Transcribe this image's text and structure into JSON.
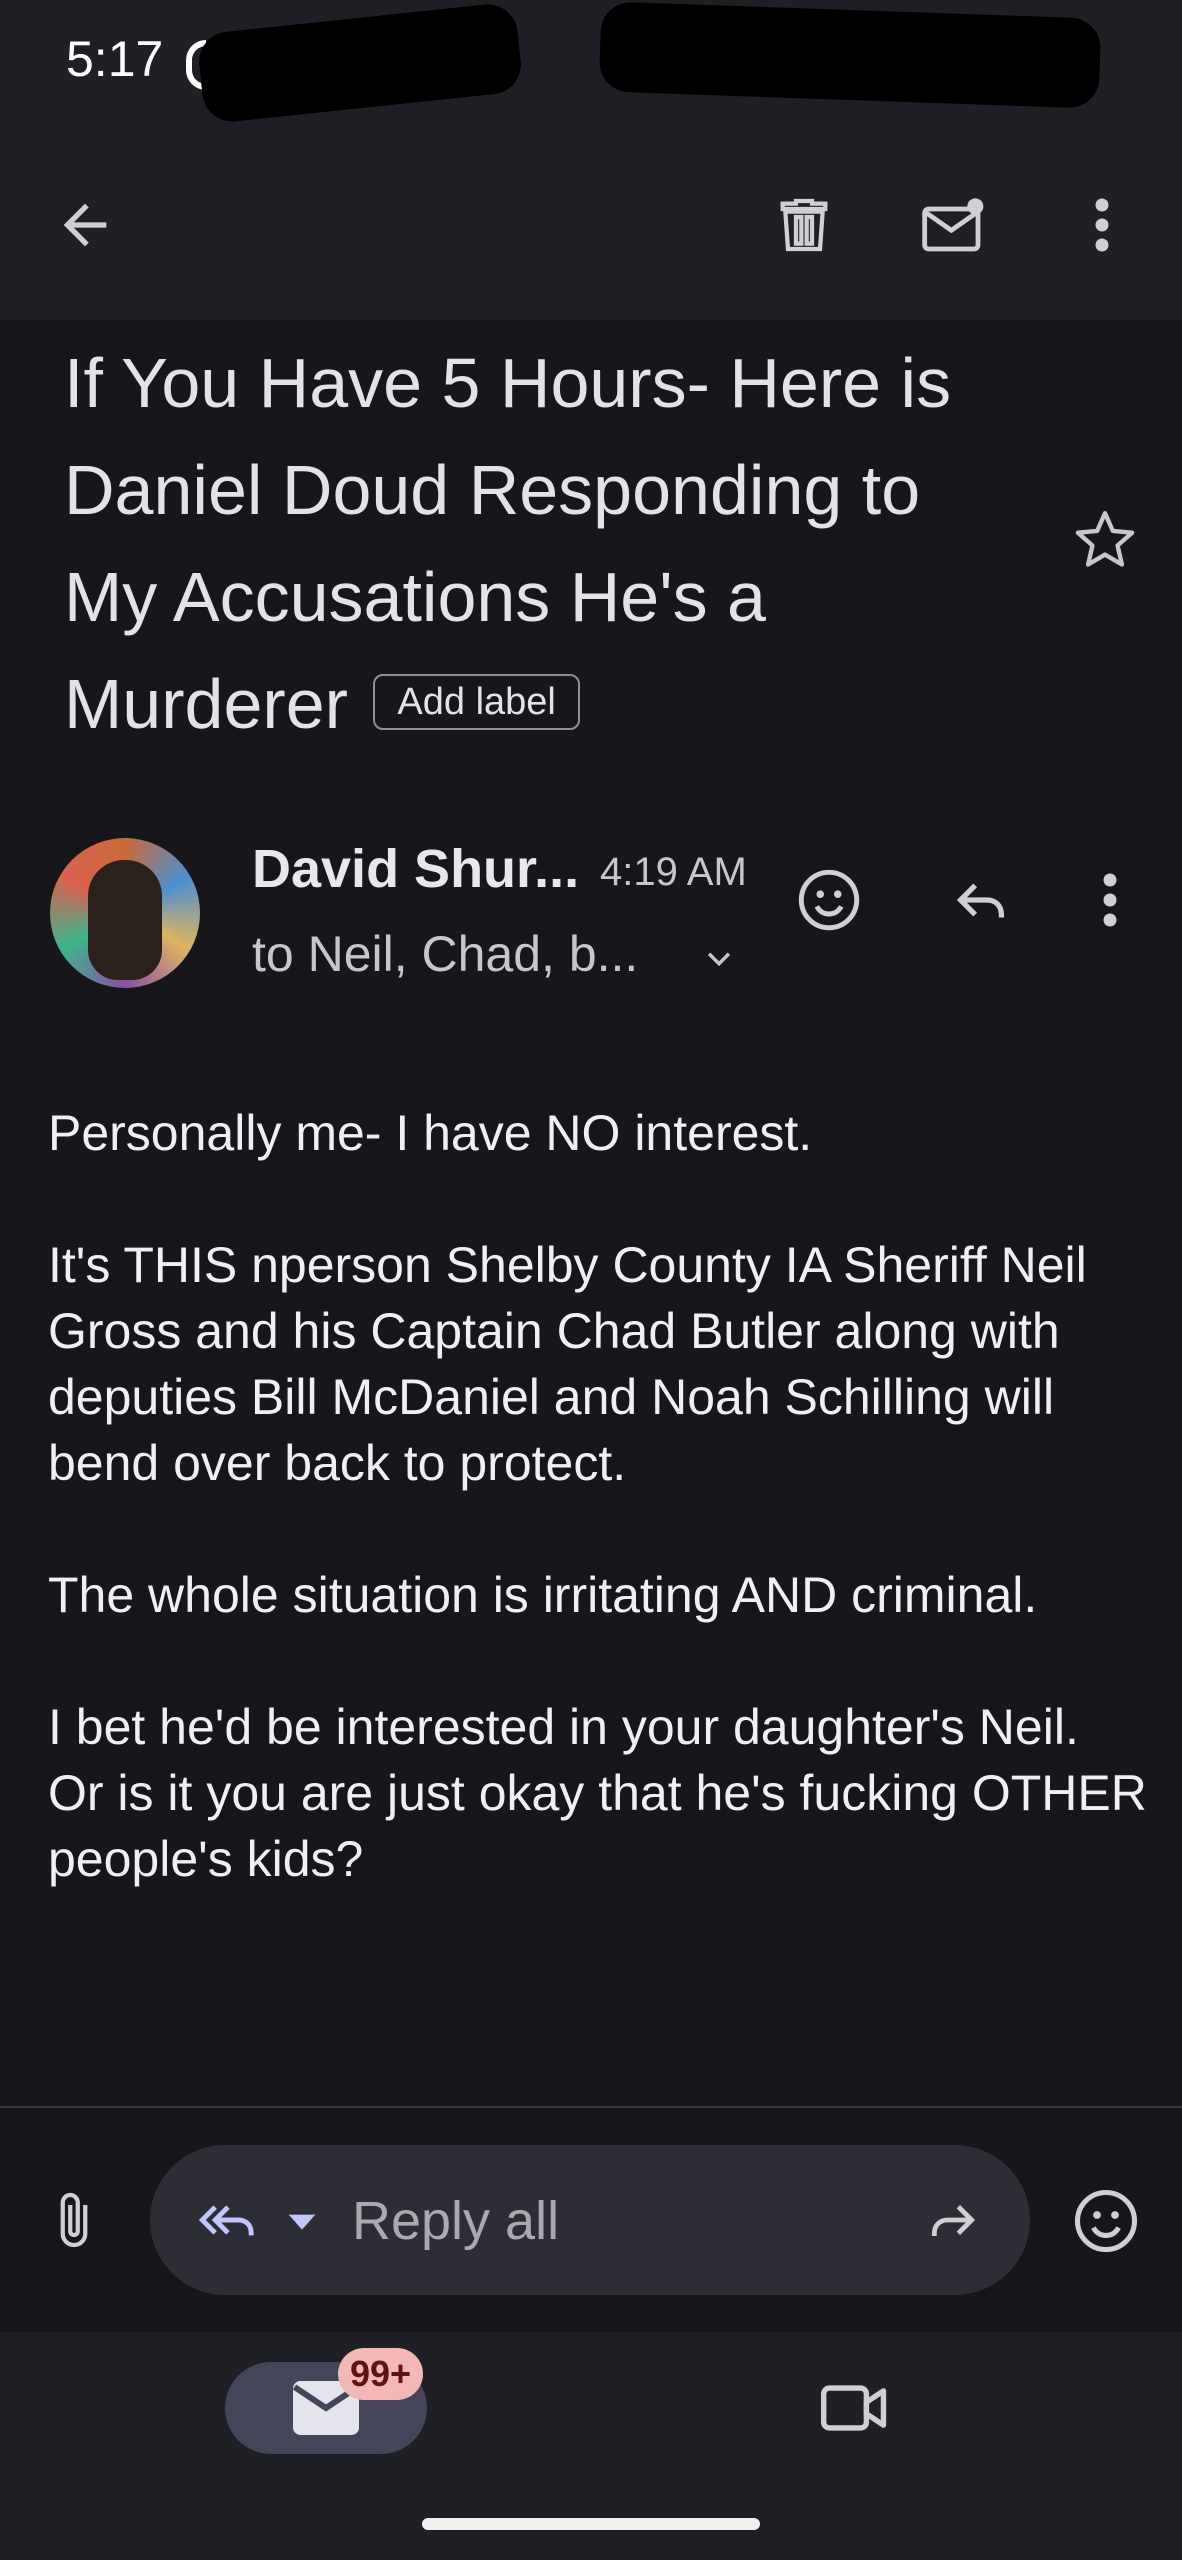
{
  "status_bar": {
    "time": "5:17"
  },
  "toolbar": {
    "back_icon": "arrow-left-icon",
    "delete_icon": "trash-icon",
    "mark_unread_icon": "mail-unread-icon",
    "more_icon": "more-vert-icon"
  },
  "email": {
    "subject": "If You Have 5 Hours- Here is Daniel Doud Responding to My Accusations He's a Murderer",
    "add_label": "Add label",
    "sender": "David Shur...",
    "time": "4:19 AM",
    "recipients": "to Neil, Chad, b...",
    "body": [
      "Personally me- I have NO interest.",
      "It's THIS nperson Shelby County IA Sheriff Neil Gross and his Captain Chad Butler along with deputies Bill McDaniel and Noah Schilling will bend over back to protect.",
      "The whole situation is irritating AND criminal.",
      "I bet he'd be interested in your daughter's Neil. Or is it you are just okay that he's fucking OTHER people's kids?"
    ]
  },
  "reply_bar": {
    "placeholder": "Reply all"
  },
  "bottom_nav": {
    "mail_badge": "99+"
  },
  "colors": {
    "background": "#16161b",
    "bar": "#1f2025",
    "accent": "#c2c6ff",
    "badge": "#f2b8b5"
  }
}
